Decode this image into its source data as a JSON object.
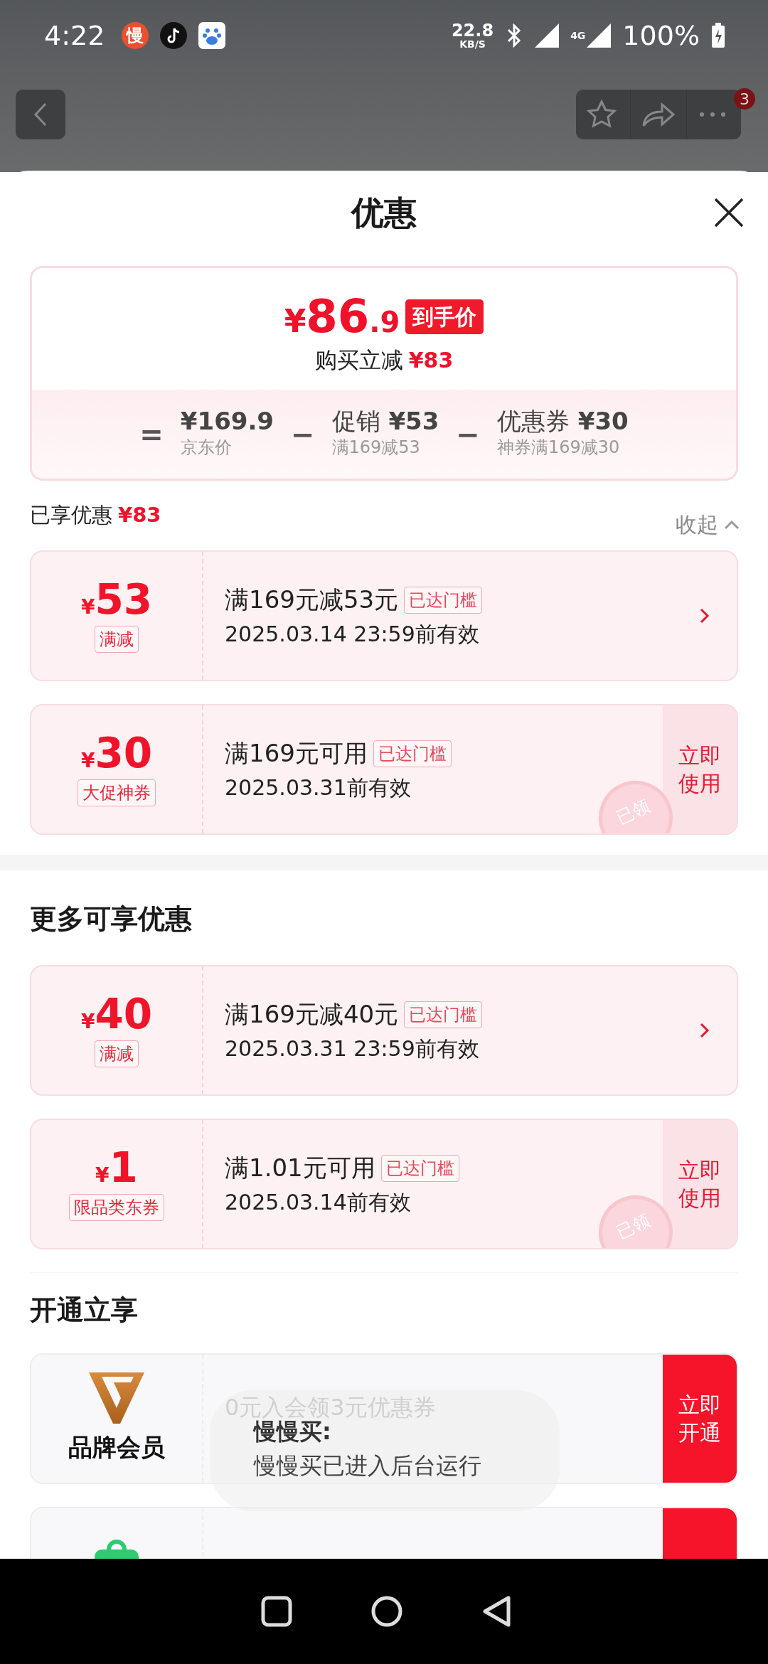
{
  "status_bar": {
    "time": "4:22",
    "app_badge": "慢",
    "net_speed": "22.8",
    "net_unit": "KB/S",
    "network": "4G",
    "battery": "100%"
  },
  "header": {
    "notification_count": "3"
  },
  "sheet": {
    "title": "优惠"
  },
  "summary": {
    "price_symbol": "¥",
    "price_int": "86",
    "price_dec": ".9",
    "price_tag": "到手价",
    "saving_label": "购买立减",
    "saving_value": "¥83",
    "equals": "=",
    "terms": [
      {
        "amount": "¥169.9",
        "note": "京东价"
      },
      {
        "operator": "−",
        "label": "促销",
        "amount": "¥53",
        "note": "满169减53"
      },
      {
        "operator": "−",
        "label": "优惠券",
        "amount": "¥30",
        "note": "神券满169减30"
      }
    ]
  },
  "enjoyed": {
    "label": "已享优惠",
    "value": "¥83",
    "toggle": "收起",
    "expanded": true
  },
  "coupons": [
    {
      "kind": "discount",
      "symbol": "¥",
      "amount": "53",
      "tag": "满减",
      "condition": "满169元减53元",
      "badge": "已达门槛",
      "validity": "2025.03.14 23:59前有效"
    },
    {
      "kind": "voucher",
      "symbol": "¥",
      "amount": "30",
      "tag": "大促神券",
      "condition": "满169元可用",
      "badge": "已达门槛",
      "validity": "2025.03.31前有效",
      "stamp": "已领",
      "action": "立即使用"
    }
  ],
  "more_title": "更多可享优惠",
  "more_coupons": [
    {
      "kind": "discount",
      "symbol": "¥",
      "amount": "40",
      "tag": "满减",
      "condition": "满169元减40元",
      "badge": "已达门槛",
      "validity": "2025.03.31 23:59前有效"
    },
    {
      "kind": "voucher",
      "symbol": "¥",
      "amount": "1",
      "tag": "限品类东券",
      "condition": "满1.01元可用",
      "badge": "已达门槛",
      "validity": "2025.03.14前有效",
      "stamp": "已领",
      "action": "立即使用"
    }
  ],
  "membership_title": "开通立享",
  "offers": [
    {
      "kind": "brand",
      "name": "品牌会员",
      "hint": "0元入会领3元优惠券",
      "action": "立即开通"
    },
    {
      "kind": "bag"
    }
  ],
  "toast": {
    "title": "慢慢买:",
    "message": "慢慢买已进入后台运行"
  }
}
